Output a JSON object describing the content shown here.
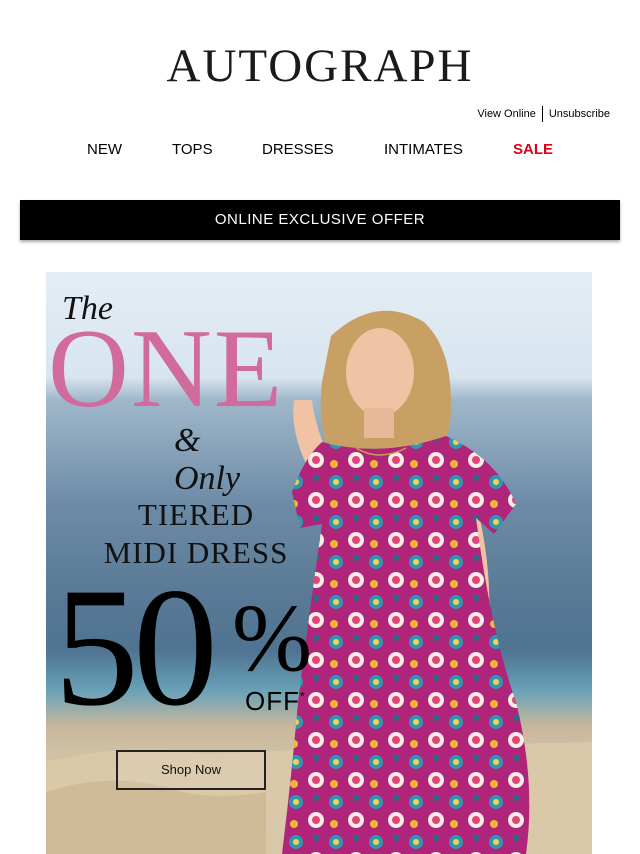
{
  "brand": {
    "logo_text": "AUTOGRAPH"
  },
  "utility_links": {
    "view_online": "View Online",
    "unsubscribe": "Unsubscribe"
  },
  "nav": {
    "items": [
      {
        "label": "NEW"
      },
      {
        "label": "TOPS"
      },
      {
        "label": "DRESSES"
      },
      {
        "label": "INTIMATES"
      },
      {
        "label": "SALE",
        "color": "#e0001b"
      }
    ]
  },
  "banner": {
    "text": "ONLINE EXCLUSIVE OFFER",
    "background": "#000000"
  },
  "hero": {
    "line_the": "The",
    "line_one": "ONE",
    "line_only": "& Only",
    "product_line_1": "TIERED",
    "product_line_2": "MIDI DRESS",
    "discount_number": "50",
    "discount_symbol": "%",
    "discount_off": "OFF",
    "discount_asterisk": "*",
    "cta_label": "Shop Now",
    "accent_color": "#d16a9d"
  }
}
